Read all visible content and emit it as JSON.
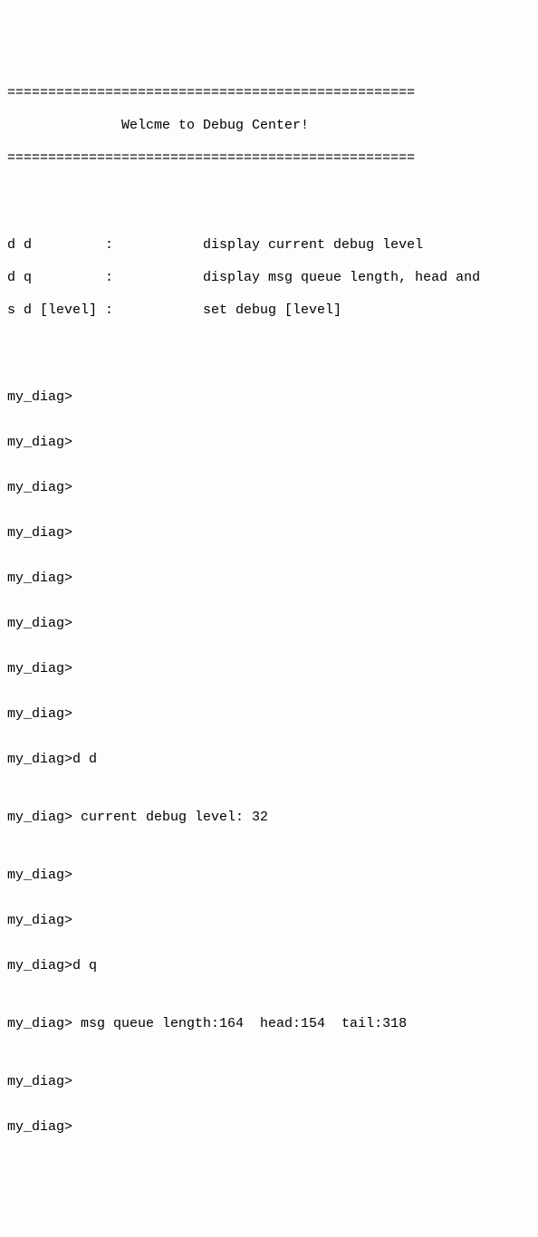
{
  "header": {
    "rule": "==================================================",
    "title": "              Welcme to Debug Center!"
  },
  "help": {
    "line1": "d d         :           display current debug level",
    "line2": "d q         :           display msg queue length, head and ",
    "line3": "s d [level] :           set debug [level]"
  },
  "prompts": {
    "empty": "my_diag>",
    "cmd_dd": "my_diag>d d",
    "resp_dd": "my_diag> current debug level: 32",
    "cmd_dq": "my_diag>d q",
    "resp_dq": "my_diag> msg queue length:164  head:154  tail:318",
    "cutoff": "my_diag>"
  }
}
